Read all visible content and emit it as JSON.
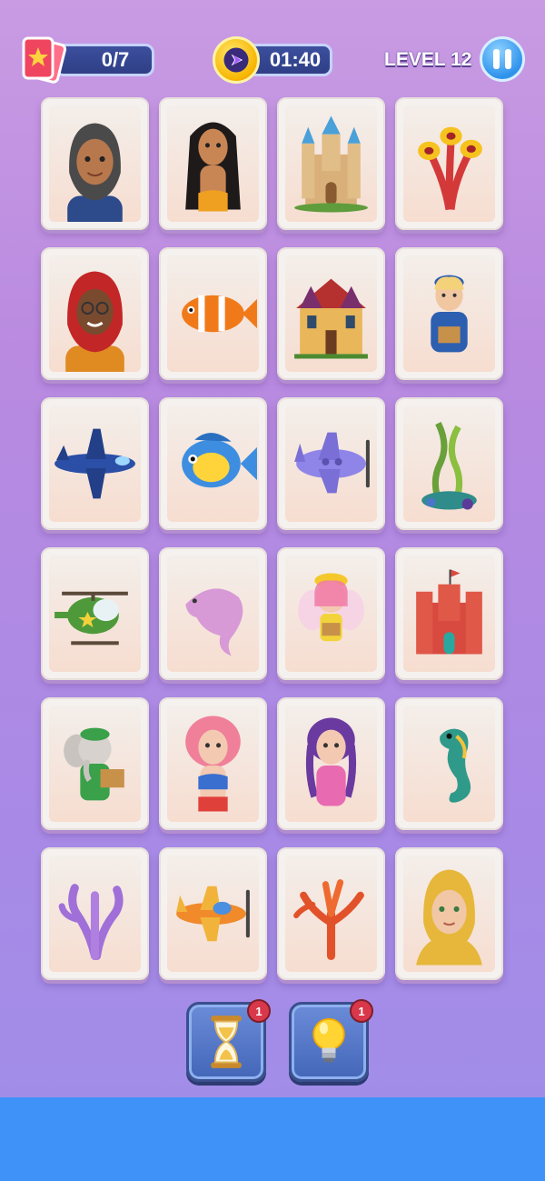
{
  "hud": {
    "cards_count": "0/7",
    "timer": "01:40",
    "level": "LEVEL 12"
  },
  "tiles": [
    {
      "name": "woman-hijab-gray"
    },
    {
      "name": "mermaid-dark-hair"
    },
    {
      "name": "sand-castle"
    },
    {
      "name": "tube-coral"
    },
    {
      "name": "woman-hijab-red-glasses"
    },
    {
      "name": "clownfish"
    },
    {
      "name": "mansion-house"
    },
    {
      "name": "delivery-boy"
    },
    {
      "name": "blue-airplane"
    },
    {
      "name": "blue-yellow-fish"
    },
    {
      "name": "purple-propeller-plane"
    },
    {
      "name": "seaweed"
    },
    {
      "name": "green-helicopter"
    },
    {
      "name": "pink-dolphin"
    },
    {
      "name": "fairy-delivery-girl"
    },
    {
      "name": "red-castle"
    },
    {
      "name": "elephant-courier"
    },
    {
      "name": "mermaid-pink-hair"
    },
    {
      "name": "girl-purple-braids"
    },
    {
      "name": "seahorse"
    },
    {
      "name": "purple-coral"
    },
    {
      "name": "orange-airplane"
    },
    {
      "name": "red-coral"
    },
    {
      "name": "woman-yellow-hijab"
    }
  ],
  "boosters": [
    {
      "name": "hourglass",
      "count": "1"
    },
    {
      "name": "lightbulb",
      "count": "1"
    }
  ]
}
